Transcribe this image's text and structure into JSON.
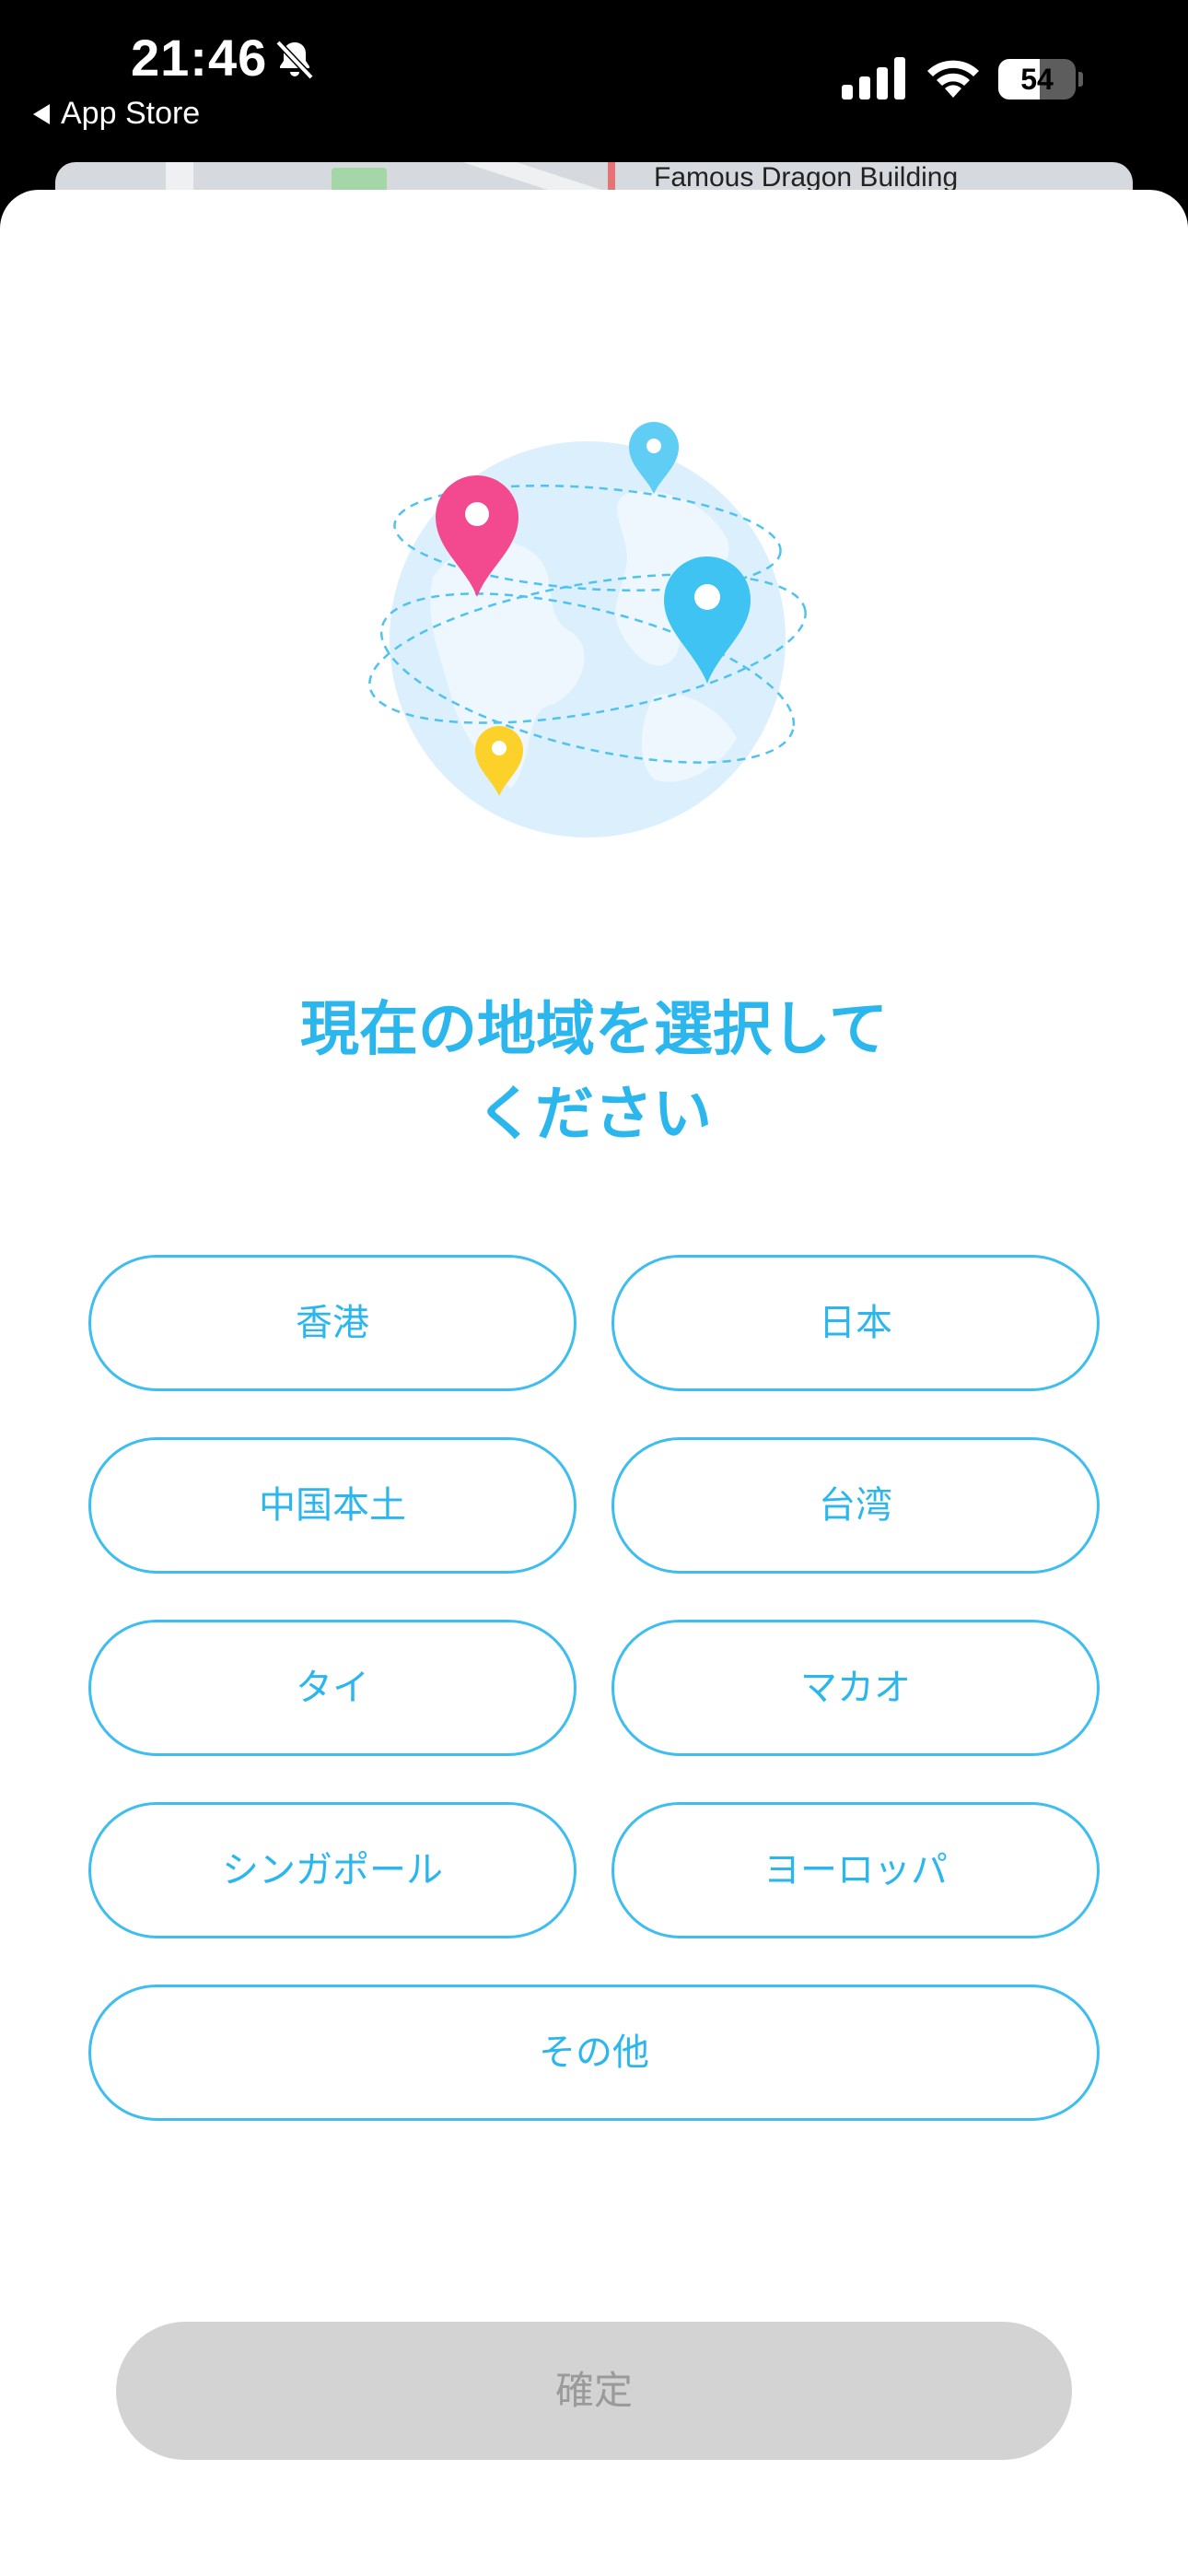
{
  "status_bar": {
    "time": "21:46",
    "back_label": "App Store",
    "battery_level": "54",
    "battery_fraction": 0.54
  },
  "background_map": {
    "label": "Famous Dragon Building"
  },
  "main": {
    "title_line1": "現在の地域を選択して",
    "title_line2": "ください",
    "regions": [
      {
        "label": "香港"
      },
      {
        "label": "日本"
      },
      {
        "label": "中国本土"
      },
      {
        "label": "台湾"
      },
      {
        "label": "タイ"
      },
      {
        "label": "マカオ"
      },
      {
        "label": "シンガポール"
      },
      {
        "label": "ヨーロッパ"
      },
      {
        "label": "その他"
      }
    ],
    "confirm_label": "確定"
  },
  "colors": {
    "accent": "#2bb7ee",
    "pin_pink": "#f2498f",
    "pin_blue": "#3fc3f2",
    "pin_yellow": "#fbd12a",
    "globe": "#dceffc",
    "disabled_bg": "#d3d3d3",
    "disabled_text": "#9a9a9a"
  },
  "icons": {
    "bell": "bell-slash-icon",
    "signal": "cellular-signal-icon",
    "wifi": "wifi-icon",
    "battery": "battery-icon",
    "illustration": "globe-with-location-pins-icon"
  }
}
